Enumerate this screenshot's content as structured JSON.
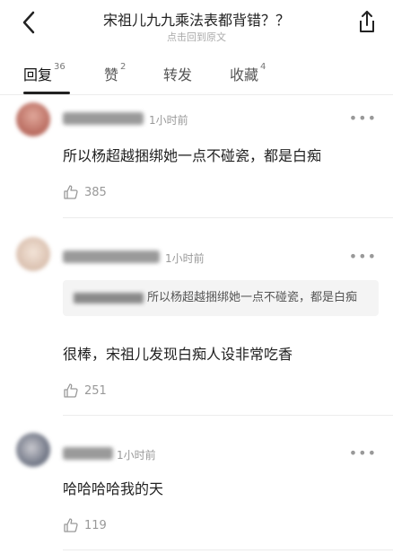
{
  "header": {
    "title": "宋祖儿九九乘法表都背错？？",
    "subtitle": "点击回到原文"
  },
  "tabs": [
    {
      "label": "回复",
      "count": "36"
    },
    {
      "label": "赞",
      "count": "2"
    },
    {
      "label": "转发",
      "count": ""
    },
    {
      "label": "收藏",
      "count": "4"
    }
  ],
  "comments": [
    {
      "time": "1小时前",
      "text": "所以杨超越捆绑她一点不碰瓷，都是白痴",
      "likes": "385"
    },
    {
      "time": "1小时前",
      "quote": "所以杨超越捆绑她一点不碰瓷，都是白痴",
      "text": "很棒，宋祖儿发现白痴人设非常吃香",
      "likes": "251"
    },
    {
      "time": "1小时前",
      "text": "哈哈哈哈我的天",
      "likes": "119"
    }
  ],
  "icons": {
    "more": "more-dots-icon",
    "like": "thumbs-up-icon"
  }
}
